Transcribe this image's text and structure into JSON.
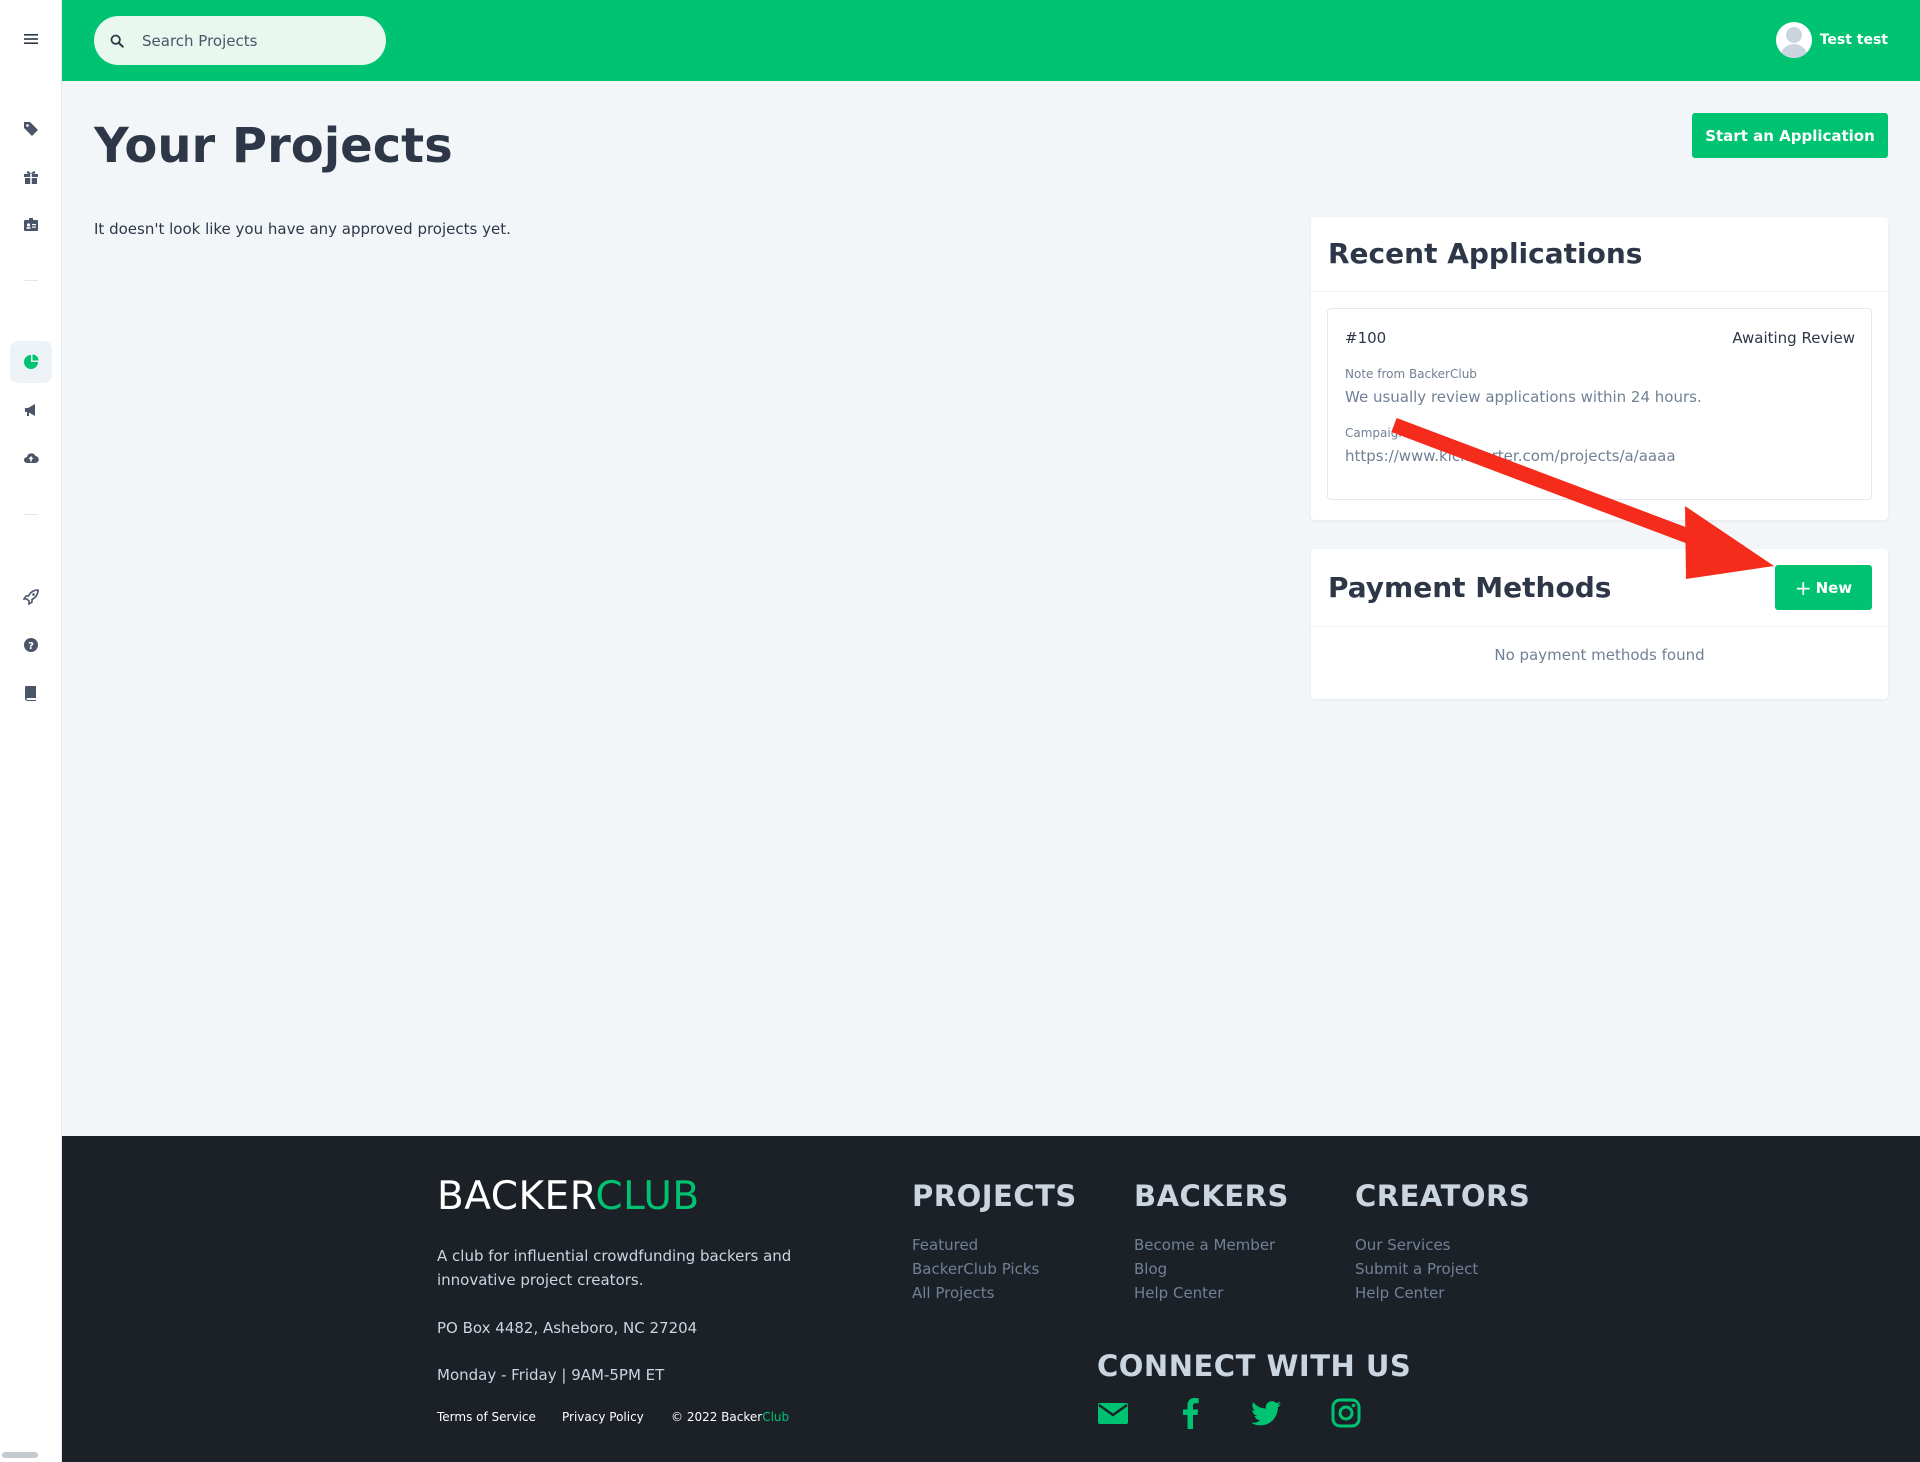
{
  "topbar": {
    "search_placeholder": "Search Projects",
    "user_name": "Test test"
  },
  "sidebar": {
    "items": [
      {
        "icon": "tag-icon"
      },
      {
        "icon": "gift-icon"
      },
      {
        "icon": "id-card-icon"
      },
      {
        "icon": "chart-pie-icon",
        "active": true
      },
      {
        "icon": "bullhorn-icon"
      },
      {
        "icon": "cloud-upload-icon"
      },
      {
        "icon": "rocket-icon"
      },
      {
        "icon": "question-circle-icon"
      },
      {
        "icon": "book-icon"
      }
    ]
  },
  "main": {
    "title": "Your Projects",
    "start_button": "Start an Application",
    "empty_message": "It doesn't look like you have any approved projects yet."
  },
  "recent_applications": {
    "title": "Recent Applications",
    "items": [
      {
        "number": "#100",
        "status": "Awaiting Review",
        "note_label": "Note from BackerClub",
        "note": "We usually review applications within 24 hours.",
        "campaign_label": "Campaign",
        "campaign_url": "https://www.kickstarter.com/projects/a/aaaa"
      }
    ]
  },
  "payment_methods": {
    "title": "Payment Methods",
    "new_button": "New",
    "empty_message": "No payment methods found"
  },
  "footer": {
    "brand_part1": "BACKER",
    "brand_part2": "CLUB",
    "tagline": "A club for influential crowdfunding backers and innovative project creators.",
    "address": "PO Box 4482, Asheboro, NC 27204",
    "hours": "Monday - Friday | 9AM-5PM ET",
    "terms": "Terms of Service",
    "privacy": "Privacy Policy",
    "copyright_prefix": "© 2022 Backer",
    "copyright_suffix": "Club",
    "columns": [
      {
        "title": "PROJECTS",
        "links": [
          "Featured",
          "BackerClub Picks",
          "All Projects"
        ]
      },
      {
        "title": "BACKERS",
        "links": [
          "Become a Member",
          "Blog",
          "Help Center"
        ]
      },
      {
        "title": "CREATORS",
        "links": [
          "Our Services",
          "Submit a Project",
          "Help Center"
        ]
      }
    ],
    "connect_title": "CONNECT WITH US",
    "social_icons": [
      "envelope-icon",
      "facebook-icon",
      "twitter-icon",
      "instagram-icon"
    ]
  },
  "colors": {
    "brand_green": "#00c371",
    "footer_bg": "#1c2027",
    "annotation_red": "#f52c1c"
  }
}
